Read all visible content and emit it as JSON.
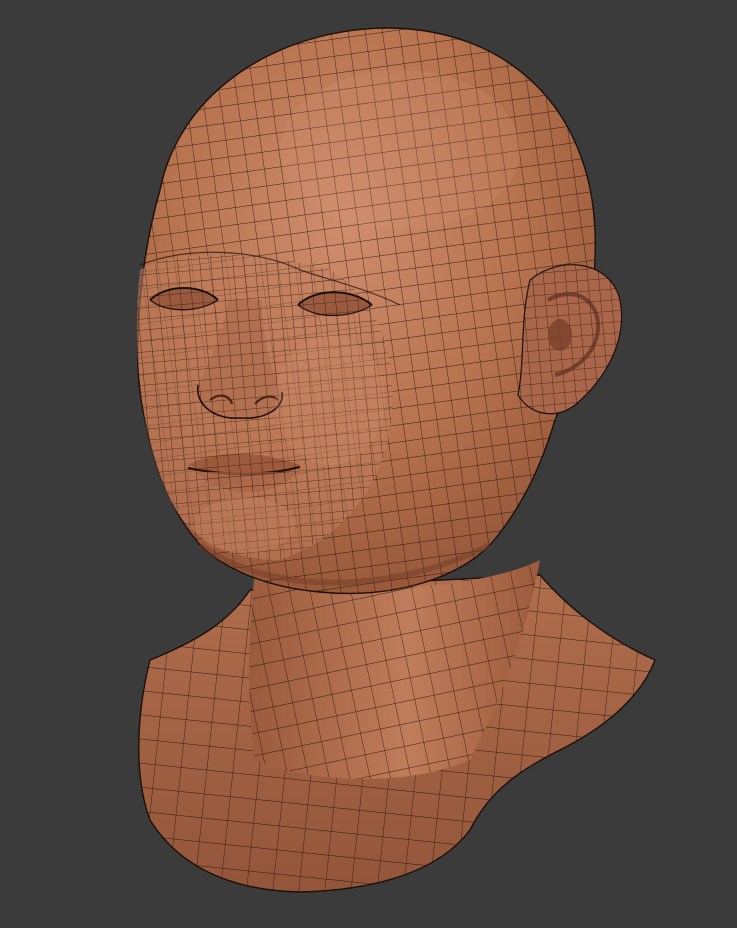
{
  "scene": {
    "subject": "wireframe-head-bust",
    "colors": {
      "background": "#3b3b3b",
      "skin_light": "#c9876a",
      "skin_mid": "#b2704f",
      "skin_dark": "#8a4e35",
      "wire": "#1d0f09"
    }
  }
}
